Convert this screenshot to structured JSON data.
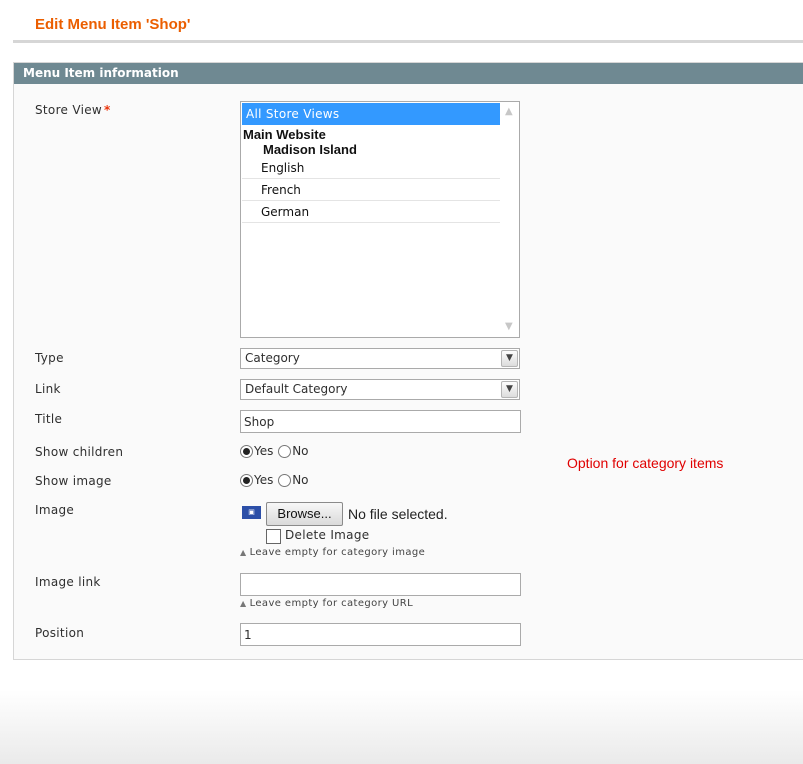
{
  "page": {
    "title": "Edit Menu Item 'Shop'"
  },
  "fieldset": {
    "legend": "Menu Item information"
  },
  "fields": {
    "store_view": {
      "label": "Store View",
      "required_mark": "*",
      "options": {
        "selected": "All Store Views",
        "website": "Main Website",
        "store": "Madison Island",
        "views": [
          "English",
          "French",
          "German"
        ]
      }
    },
    "type": {
      "label": "Type",
      "value": "Category"
    },
    "link": {
      "label": "Link",
      "value": "Default Category"
    },
    "title": {
      "label": "Title",
      "value": "Shop"
    },
    "show_children": {
      "label": "Show children",
      "yes": "Yes",
      "no": "No",
      "selected": "Yes"
    },
    "show_image": {
      "label": "Show image",
      "yes": "Yes",
      "no": "No",
      "selected": "Yes"
    },
    "image": {
      "label": "Image",
      "browse_label": "Browse...",
      "file_status": "No file selected.",
      "delete_label": "Delete Image",
      "hint": "Leave empty for category image",
      "thumb_icon": "image-thumbnail-icon"
    },
    "image_link": {
      "label": "Image link",
      "value": "",
      "hint": "Leave empty for category URL"
    },
    "position": {
      "label": "Position",
      "value": "1"
    }
  },
  "annotation": {
    "text": "Option for category items",
    "color": "#e00000"
  },
  "colors": {
    "title": "#eb5e00",
    "legend_bg": "#6f8992",
    "selected_option": "#3399ff"
  }
}
